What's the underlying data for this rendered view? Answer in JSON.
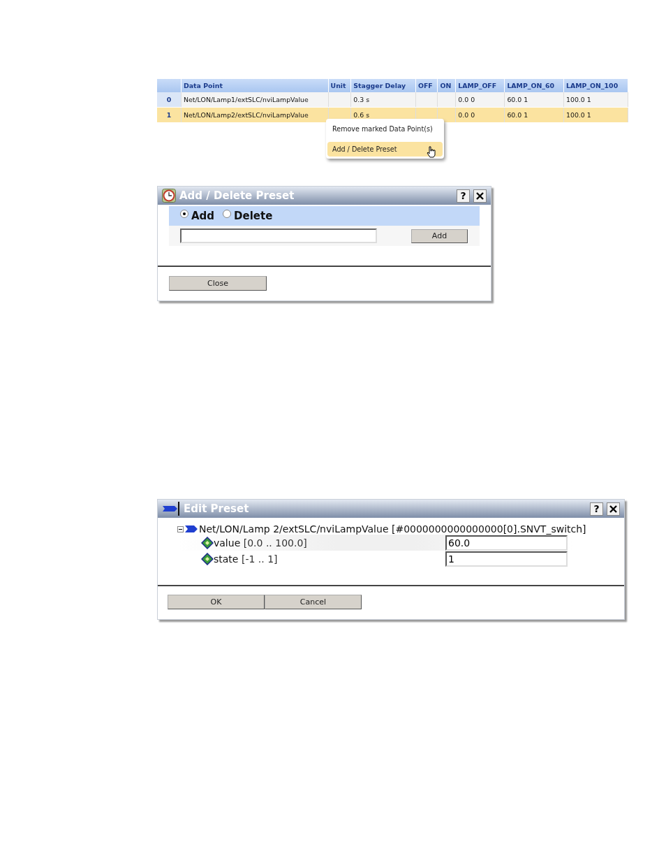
{
  "table": {
    "columns": [
      "Data Point",
      "Unit",
      "Stagger Delay",
      "OFF",
      "ON",
      "LAMP_OFF",
      "LAMP_ON_60",
      "LAMP_ON_100"
    ],
    "rows": [
      {
        "index": "0",
        "data_point": "Net/LON/Lamp1/extSLC/nviLampValue",
        "stagger_delay": "0.3 s",
        "lamp_off": "0.0 0",
        "lamp_on_60": "60.0 1",
        "lamp_on_100": "100.0 1",
        "selected": false
      },
      {
        "index": "1",
        "data_point": "Net/LON/Lamp2/extSLC/nviLampValue",
        "stagger_delay": "0.6 s",
        "lamp_off": "0.0 0",
        "lamp_on_60": "60.0 1",
        "lamp_on_100": "100.0 1",
        "selected": true
      }
    ]
  },
  "context_menu": {
    "items": [
      {
        "label": "Remove marked Data Point(s)",
        "selected": false
      },
      {
        "label": "Add / Delete Preset",
        "selected": true
      }
    ]
  },
  "preset_dialog": {
    "title": "Add / Delete Preset",
    "help": "?",
    "modes": [
      {
        "label": "Add",
        "selected": true
      },
      {
        "label": "Delete",
        "selected": false
      }
    ],
    "action_button": "Add",
    "close_button": "Close"
  },
  "edit_dialog": {
    "title": "Edit Preset",
    "help": "?",
    "tree": {
      "label": "Net/LON/Lamp 2/extSLC/nviLampValue [#0000000000000000[0].SNVT_switch]",
      "expanded": true,
      "children": [
        {
          "name": "value",
          "range": "[0.0 .. 100.0]",
          "value": "60.0"
        },
        {
          "name": "state",
          "range": "[-1 .. 1]",
          "value": "1"
        }
      ]
    },
    "buttons": [
      "OK",
      "Cancel"
    ]
  }
}
